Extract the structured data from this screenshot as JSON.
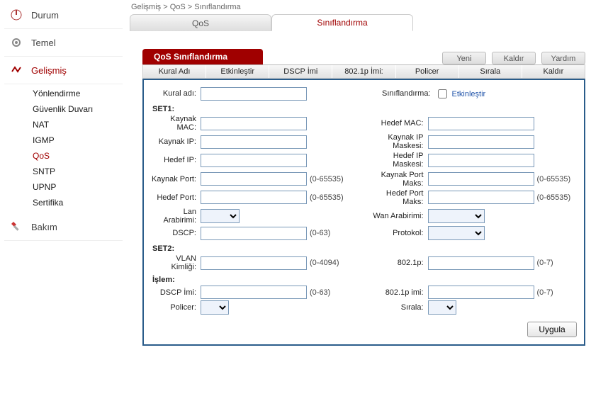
{
  "breadcrumb": "Gelişmiş > QoS > Sınıflandırma",
  "sidebar": {
    "items": [
      {
        "label": "Durum"
      },
      {
        "label": "Temel"
      },
      {
        "label": "Gelişmiş"
      },
      {
        "label": "Bakım"
      }
    ],
    "sub": [
      {
        "label": "Yönlendirme"
      },
      {
        "label": "Güvenlik Duvarı"
      },
      {
        "label": "NAT"
      },
      {
        "label": "IGMP"
      },
      {
        "label": "QoS"
      },
      {
        "label": "SNTP"
      },
      {
        "label": "UPNP"
      },
      {
        "label": "Sertifika"
      }
    ]
  },
  "tabs": {
    "qos": "QoS",
    "classification": "Sınıflandırma"
  },
  "banner": "QoS Sınıflandırma",
  "top_buttons": {
    "new": "Yeni",
    "remove": "Kaldır",
    "help": "Yardım"
  },
  "columns": {
    "rule": "Kural Adı",
    "enable": "Etkinleştir",
    "dscp": "DSCP İmi",
    "p8021": "802.1p İmi:",
    "policer": "Policer",
    "order": "Sırala",
    "remove": "Kaldır"
  },
  "form": {
    "rule_name_label": "Kural adı:",
    "classification_label": "Sınıflandırma:",
    "enable_label": "Etkinleştir",
    "set1": "SET1:",
    "src_mac": "Kaynak MAC:",
    "dst_mac": "Hedef MAC:",
    "src_ip": "Kaynak IP:",
    "src_ip_mask": "Kaynak IP Maskesi:",
    "dst_ip": "Hedef IP:",
    "dst_ip_mask": "Hedef IP Maskesi:",
    "src_port": "Kaynak Port:",
    "src_port_max": "Kaynak Port Maks:",
    "dst_port": "Hedef Port:",
    "dst_port_max": "Hedef Port Maks:",
    "lan_if": "Lan Arabirimi:",
    "wan_if": "Wan Arabirimi:",
    "dscp": "DSCP:",
    "proto": "Protokol:",
    "set2": "SET2:",
    "vlan_id": "VLAN Kimliği:",
    "p8021": "802.1p:",
    "action": "İşlem:",
    "dscp_mark": "DSCP İmi:",
    "p8021_mark": "802.1p imi:",
    "policer": "Policer:",
    "order": "Sırala:",
    "range_port": "(0-65535)",
    "range_dscp": "(0-63)",
    "range_vlan": "(0-4094)",
    "range_8021p": "(0-7)",
    "apply": "Uygula"
  }
}
